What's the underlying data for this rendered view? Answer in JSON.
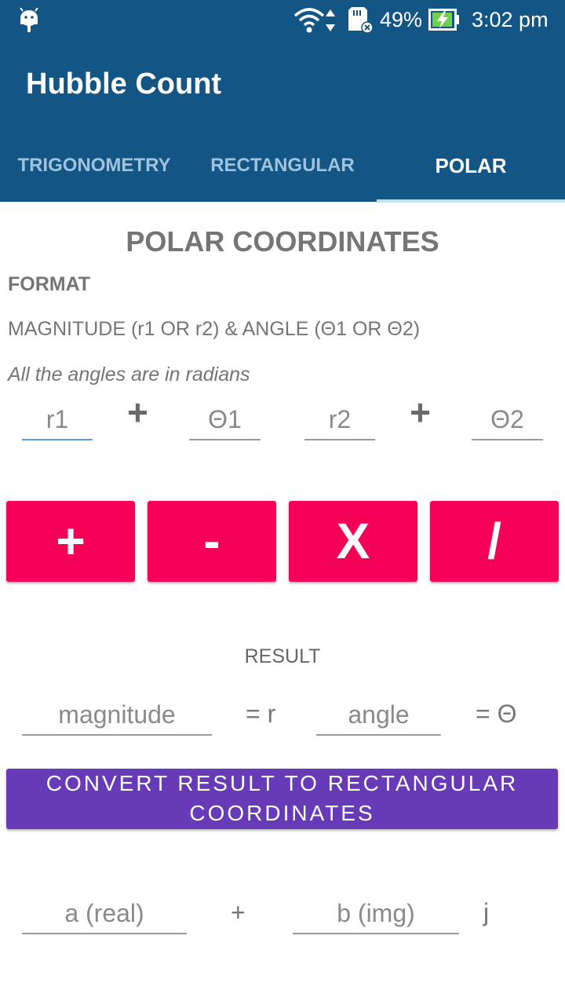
{
  "status_bar": {
    "battery_percent": "49%",
    "time": "3:02 pm"
  },
  "app": {
    "title": "Hubble Count"
  },
  "tabs": [
    {
      "label": "TRIGONOMETRY",
      "active": false
    },
    {
      "label": "RECTANGULAR",
      "active": false
    },
    {
      "label": "POLAR",
      "active": true
    }
  ],
  "content": {
    "heading": "POLAR COORDINATES",
    "format_label": "FORMAT",
    "format_desc": "MAGNITUDE (r1 OR r2) & ANGLE (Θ1 OR Θ2)",
    "angle_note": "All the angles are in radians",
    "inputs": {
      "r1_placeholder": "r1",
      "theta1_placeholder": "Θ1",
      "r2_placeholder": "r2",
      "theta2_placeholder": "Θ2"
    },
    "plus_sign": "+",
    "operations": [
      "+",
      "-",
      "X",
      "/"
    ],
    "result_label": "RESULT",
    "result": {
      "magnitude_placeholder": "magnitude",
      "eq_r": "= r",
      "angle_placeholder": "angle",
      "eq_theta": "= Θ"
    },
    "convert_button": "CONVERT RESULT TO RECTANGULAR COORDINATES",
    "rectangular": {
      "real_placeholder": "a (real)",
      "plus": "+",
      "img_placeholder": "b (img)",
      "j": "j"
    }
  },
  "colors": {
    "primary": "#135686",
    "accent": "#f50057",
    "convert": "#673ab7"
  }
}
